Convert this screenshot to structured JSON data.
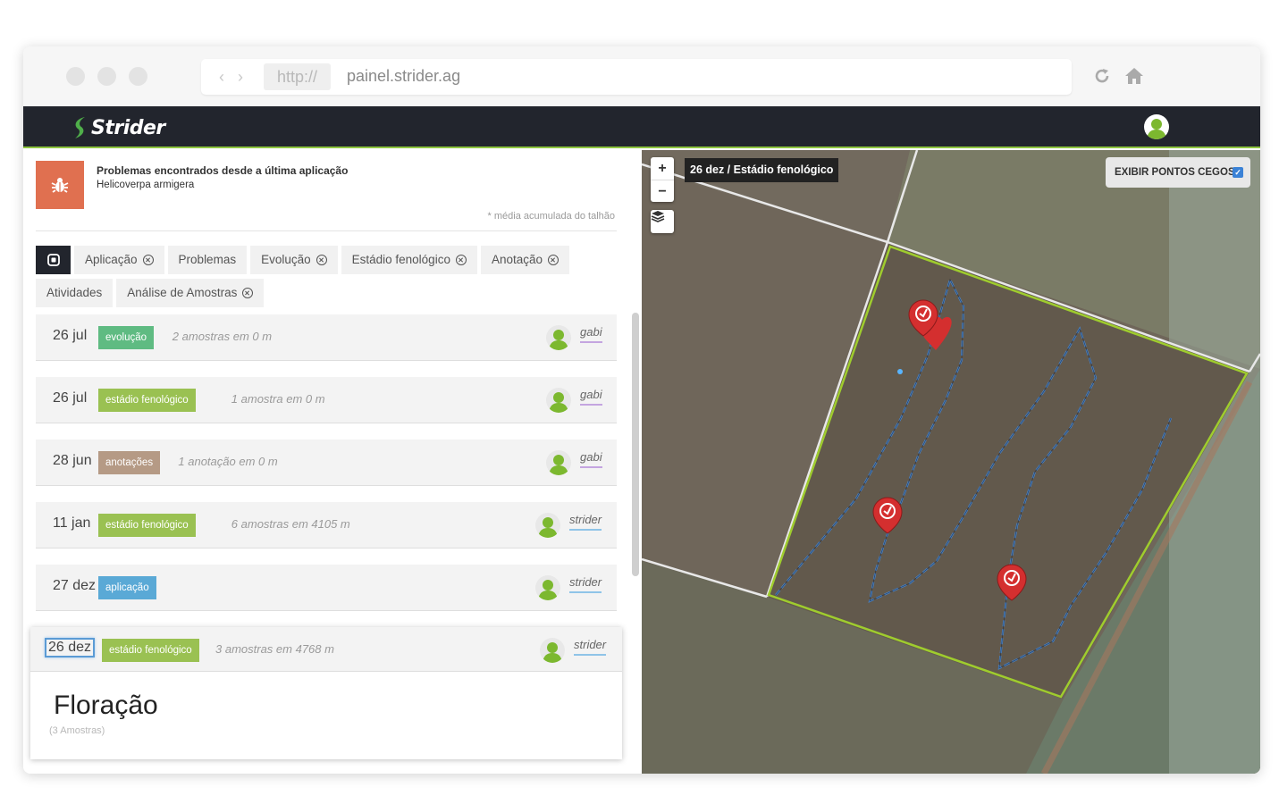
{
  "browser": {
    "protocol": "http://",
    "url": "painel.strider.ag"
  },
  "app": {
    "brand": "Strider"
  },
  "alert": {
    "icon": "bug-icon",
    "title": "Problemas encontrados desde a última aplicação",
    "pest": "Helicoverpa armigera",
    "note": "* média acumulada do talhão"
  },
  "filters": {
    "row1": [
      "Aplicação",
      "Problemas",
      "Evolução",
      "Estádio fenológico",
      "Anotação"
    ],
    "row2": [
      "Atividades",
      "Análise de Amostras"
    ]
  },
  "entries": [
    {
      "date": "26 jul",
      "badge": "evolução",
      "badge_color": "#5fbb82",
      "info": "2 amostras em 0 m",
      "user": "gabi"
    },
    {
      "date": "26 jul",
      "badge": "estádio fenológico",
      "badge_color": "#9ac152",
      "info": "1 amostra em 0 m",
      "user": "gabi"
    },
    {
      "date": "28 jun",
      "badge": "anotações",
      "badge_color": "#b59a85",
      "info": "1 anotação em 0 m",
      "user": "gabi"
    },
    {
      "date": "11 jan",
      "badge": "estádio fenológico",
      "badge_color": "#9ac152",
      "info": "6 amostras em 4105 m",
      "user": "strider"
    },
    {
      "date": "27 dez",
      "badge": "aplicação",
      "badge_color": "#5aa9d6",
      "info": "",
      "user": "strider"
    }
  ],
  "expanded": {
    "date": "26 dez",
    "badge": "estádio fenológico",
    "badge_color": "#9ac152",
    "info": "3 amostras em 4768 m",
    "user": "strider",
    "stage": "Floração",
    "count": "(3 Amostras)"
  },
  "map": {
    "zoom_in": "+",
    "zoom_out": "−",
    "label": "26 dez / Estádio fenológico",
    "blind_spots": "EXIBIR PONTOS CEGOS",
    "blind_spots_checked": true
  }
}
